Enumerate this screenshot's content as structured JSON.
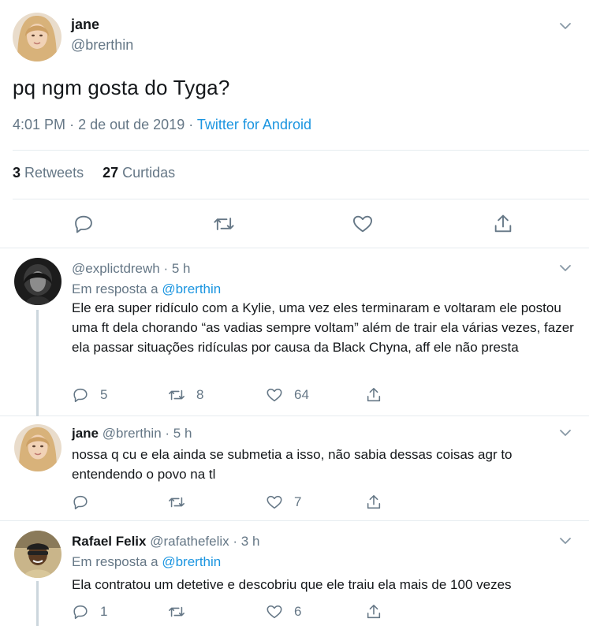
{
  "main_tweet": {
    "name": "jane",
    "handle": "@brerthin",
    "text": "pq ngm gosta do Tyga?",
    "time": "4:01 PM",
    "sep": "·",
    "date": "2 de out de 2019",
    "source": "Twitter for Android",
    "retweets_count": "3",
    "retweets_label": "Retweets",
    "likes_count": "27",
    "likes_label": "Curtidas"
  },
  "replies": [
    {
      "name": "",
      "handle": "@explictdrewh",
      "time_ago": "· 5 h",
      "reply_prefix": "Em resposta a",
      "reply_to": "@brerthin",
      "text": "Ele era super ridículo com a Kylie, uma vez eles terminaram e voltaram ele postou uma ft dela chorando “as vadias sempre voltam” além de trair ela várias vezes, fazer ela passar situações ridículas por causa da Black Chyna, aff ele não presta",
      "replies": "5",
      "retweets": "8",
      "likes": "64"
    },
    {
      "name": "jane",
      "handle": "@brerthin",
      "time_ago": "· 5 h",
      "text": "nossa q cu e ela ainda se submetia a isso, não sabia dessas coisas agr to entendendo o povo na tl",
      "replies": "",
      "retweets": "",
      "likes": "7"
    },
    {
      "name": "Rafael Felix",
      "handle": "@rafathefelix",
      "time_ago": "· 3 h",
      "reply_prefix": "Em resposta a",
      "reply_to": "@brerthin",
      "text": "Ela contratou um detetive e descobriu que ele traiu ela mais de 100 vezes",
      "replies": "1",
      "retweets": "",
      "likes": "6"
    }
  ],
  "colors": {
    "link": "#1b95e0",
    "secondary_text": "#657786",
    "border": "#e6ecf0"
  },
  "icons": [
    "chevron-down-icon",
    "reply-icon",
    "retweet-icon",
    "like-icon",
    "share-icon"
  ]
}
